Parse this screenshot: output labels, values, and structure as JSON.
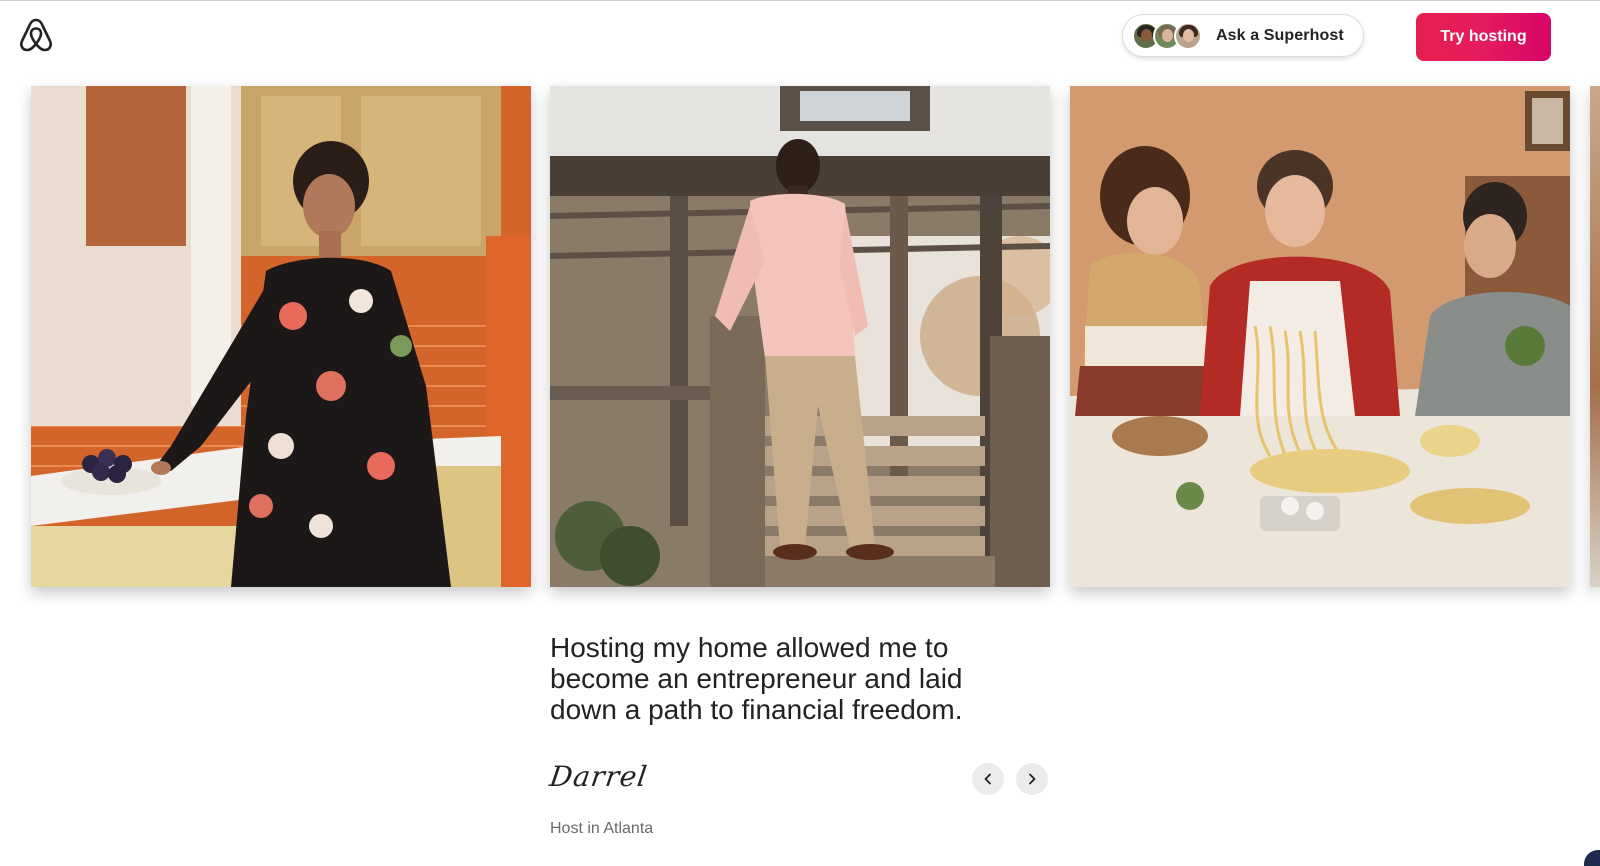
{
  "header": {
    "logo_icon": "airbnb-logo-icon",
    "superhost_label": "Ask a Superhost",
    "try_hosting_label": "Try hosting",
    "brand_color": "#E31C5F"
  },
  "carousel": {
    "slides": [
      {
        "subject": "woman-in-kitchen-photo"
      },
      {
        "subject": "man-on-porch-photo"
      },
      {
        "subject": "family-making-pasta-photo"
      }
    ],
    "prev_icon": "chevron-left-icon",
    "next_icon": "chevron-right-icon"
  },
  "testimonial": {
    "quote": "Hosting my home allowed me to become an entrepreneur and laid down a path to financial freedom.",
    "signature": "Darrel",
    "host_location": "Host in Atlanta"
  }
}
